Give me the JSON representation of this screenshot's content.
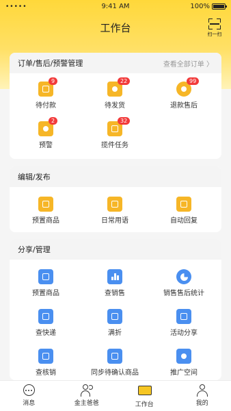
{
  "status_bar": {
    "signal": "•••••",
    "time": "9:41 AM",
    "battery": "100%"
  },
  "header": {
    "title": "工作台",
    "scan_label": "扫一扫"
  },
  "orders": {
    "title": "订单/售后/预警管理",
    "link": "查看全部订单 〉",
    "items": [
      {
        "label": "待付款",
        "badge": "9",
        "icon": "wallet-icon"
      },
      {
        "label": "待发货",
        "badge": "22",
        "icon": "location-pin-icon"
      },
      {
        "label": "退款售后",
        "badge": "99",
        "icon": "refund-icon"
      },
      {
        "label": "预警",
        "badge": "2",
        "icon": "alarm-icon"
      },
      {
        "label": "揽件任务",
        "badge": "32",
        "icon": "package-icon"
      }
    ]
  },
  "edit": {
    "title": "编辑/发布",
    "items": [
      {
        "label": "预置商品",
        "icon": "clipboard-icon"
      },
      {
        "label": "日常用语",
        "icon": "message-icon"
      },
      {
        "label": "自动回复",
        "icon": "reply-icon"
      }
    ]
  },
  "share": {
    "title": "分享/管理",
    "items": [
      {
        "label": "预置商品",
        "icon": "document-icon"
      },
      {
        "label": "查销售",
        "icon": "bar-chart-icon"
      },
      {
        "label": "销售售后统计",
        "icon": "pie-chart-icon"
      },
      {
        "label": "查快递",
        "icon": "truck-icon"
      },
      {
        "label": "满折",
        "icon": "coupon-icon"
      },
      {
        "label": "活动分享",
        "icon": "flag-icon"
      },
      {
        "label": "查核销",
        "icon": "check-ticket-icon"
      },
      {
        "label": "同步待确认商品",
        "icon": "list-icon"
      },
      {
        "label": "推广空间",
        "icon": "share-icon"
      }
    ]
  },
  "tabbar": [
    {
      "label": "消息",
      "icon": "chat-icon"
    },
    {
      "label": "金主爸爸",
      "icon": "users-icon"
    },
    {
      "label": "工作台",
      "icon": "desk-icon"
    },
    {
      "label": "我的",
      "icon": "person-icon"
    }
  ],
  "colors": {
    "accent_yellow": "#ffd83a",
    "icon_yellow": "#f6b627",
    "icon_blue": "#4a8ff0",
    "badge_red": "#f23a3a"
  }
}
